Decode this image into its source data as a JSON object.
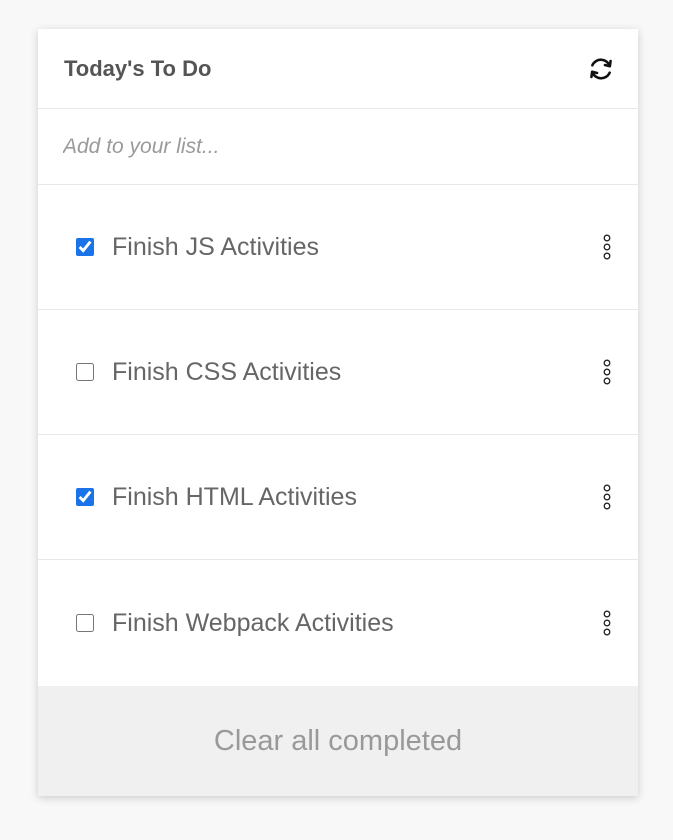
{
  "header": {
    "title": "Today's To Do",
    "refresh_icon": "refresh-icon"
  },
  "add": {
    "placeholder": "Add to your list..."
  },
  "items": [
    {
      "label": "Finish JS Activities",
      "checked": true
    },
    {
      "label": "Finish CSS Activities",
      "checked": false
    },
    {
      "label": "Finish HTML Activities",
      "checked": true
    },
    {
      "label": "Finish Webpack Activities",
      "checked": false
    }
  ],
  "item_menu_icon": "vertical-dots-icon",
  "footer": {
    "clear_label": "Clear all completed"
  },
  "colors": {
    "checkbox_accent": "#1a73e8",
    "footer_bg": "#f0f0f0"
  }
}
